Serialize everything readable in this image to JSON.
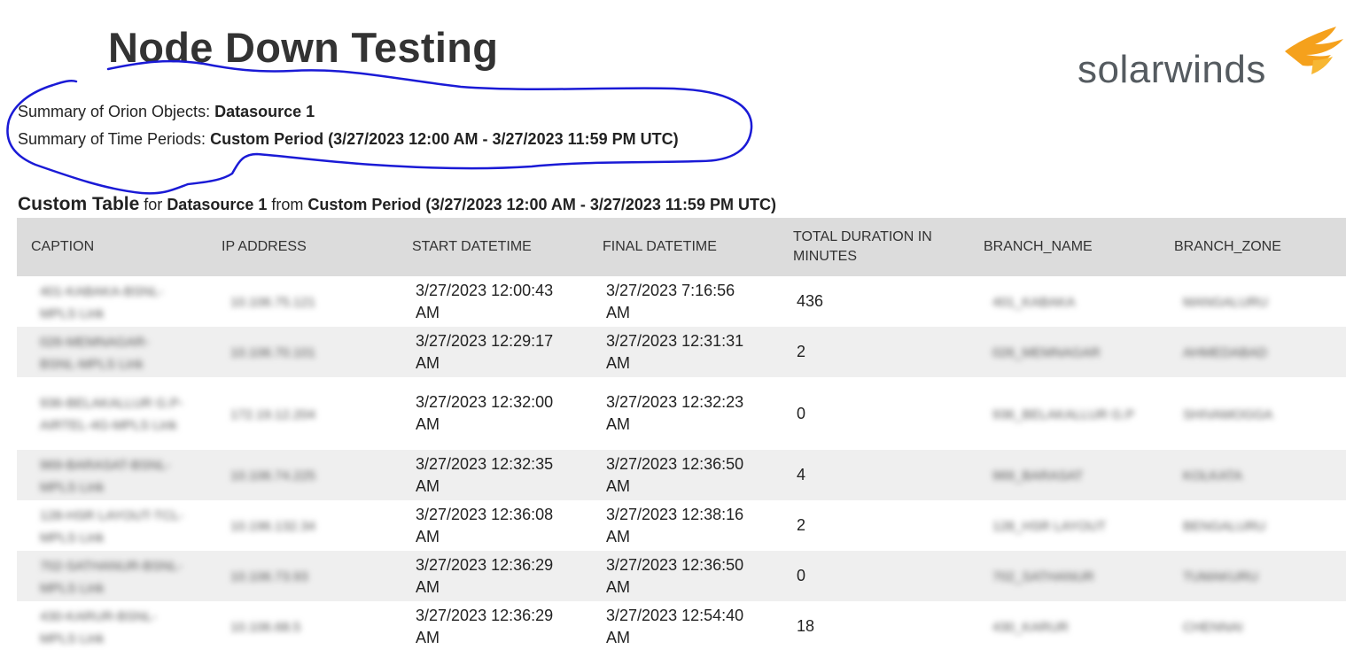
{
  "report": {
    "title": "Node Down Testing",
    "logo_text": "solarwinds",
    "summary_objects_label": "Summary of Orion Objects: ",
    "summary_objects_value": "Datasource 1",
    "summary_periods_label": "Summary of Time Periods: ",
    "summary_periods_value": "Custom Period (3/27/2023 12:00 AM - 3/27/2023 11:59 PM UTC)"
  },
  "table_heading": {
    "name": "Custom Table",
    "for_word": " for ",
    "datasource": "Datasource 1",
    "from_word": " from ",
    "period": "Custom Period (3/27/2023 12:00 AM - 3/27/2023 11:59 PM UTC)"
  },
  "columns": [
    "CAPTION",
    "IP ADDRESS",
    "START DATETIME",
    "FINAL DATETIME",
    "TOTAL DURATION IN MINUTES",
    "BRANCH_NAME",
    "BRANCH_ZONE"
  ],
  "rows": [
    {
      "caption": "401-KABAKA-BSNL-MPLS Link",
      "ip": "10.106.75.121",
      "start": "3/27/2023 12:00:43 AM",
      "final": "3/27/2023 7:16:56 AM",
      "duration": "436",
      "branch_name": "401_KABAKA",
      "branch_zone": "MANGALURU"
    },
    {
      "caption": "026-MEMNAGAR-BSNL-MPLS Link",
      "ip": "10.106.70.101",
      "start": "3/27/2023 12:29:17 AM",
      "final": "3/27/2023 12:31:31 AM",
      "duration": "2",
      "branch_name": "026_MEMNAGAR",
      "branch_zone": "AHMEDABAD"
    },
    {
      "caption": "936-BELAKALLUR G.P-AIRTEL-4G-MPLS Link",
      "ip": "172.19.12.204",
      "start": "3/27/2023 12:32:00 AM",
      "final": "3/27/2023 12:32:23 AM",
      "duration": "0",
      "branch_name": "936_BELAKALLUR G.P",
      "branch_zone": "SHIVAMOGGA"
    },
    {
      "caption": "969-BARASAT-BSNL-MPLS Link",
      "ip": "10.106.74.225",
      "start": "3/27/2023 12:32:35 AM",
      "final": "3/27/2023 12:36:50 AM",
      "duration": "4",
      "branch_name": "969_BARASAT",
      "branch_zone": "KOLKATA"
    },
    {
      "caption": "128-HSR LAYOUT-TCL-MPLS Link",
      "ip": "10.196.132.34",
      "start": "3/27/2023 12:36:08 AM",
      "final": "3/27/2023 12:38:16 AM",
      "duration": "2",
      "branch_name": "128_HSR LAYOUT",
      "branch_zone": "BENGALURU"
    },
    {
      "caption": "702-SATHANUR-BSNL-MPLS Link",
      "ip": "10.106.73.93",
      "start": "3/27/2023 12:36:29 AM",
      "final": "3/27/2023 12:36:50 AM",
      "duration": "0",
      "branch_name": "702_SATHANUR",
      "branch_zone": "TUMAKURU"
    },
    {
      "caption": "430-KARUR-BSNL-MPLS Link",
      "ip": "10.106.68.5",
      "start": "3/27/2023 12:36:29 AM",
      "final": "3/27/2023 12:54:40 AM",
      "duration": "18",
      "branch_name": "430_KARUR",
      "branch_zone": "CHENNAI"
    }
  ],
  "colors": {
    "header_bg": "#dcdcdc",
    "stripe_bg": "#efefef",
    "annotation_stroke": "#1a1ad6",
    "logo_flame": "#f5a11c",
    "logo_text": "#555b60"
  }
}
